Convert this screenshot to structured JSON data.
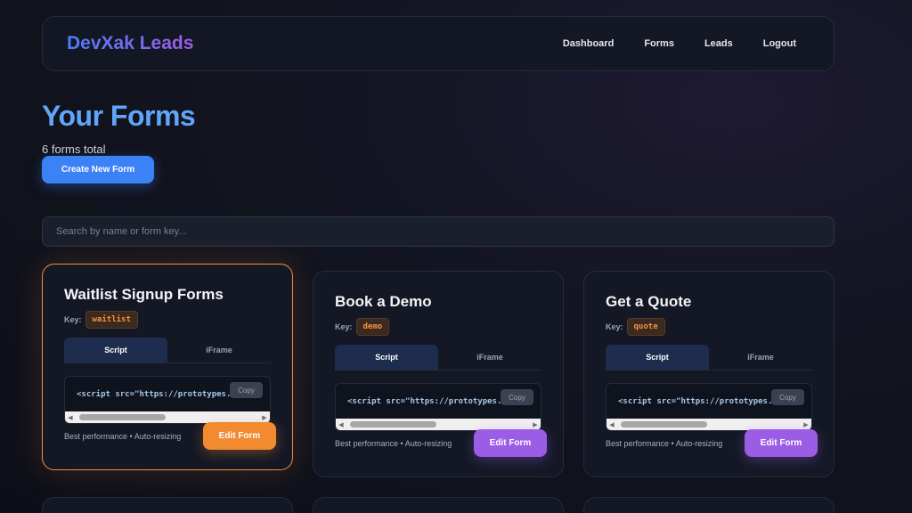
{
  "nav": {
    "brand": "DevXak Leads",
    "links": [
      "Dashboard",
      "Forms",
      "Leads",
      "Logout"
    ]
  },
  "header": {
    "title": "Your Forms",
    "count": "6 forms total",
    "create_label": "Create New Form"
  },
  "search": {
    "placeholder": "Search by name or form key..."
  },
  "common": {
    "key_label": "Key:",
    "tab_script": "Script",
    "tab_iframe": "iFrame",
    "code_snippet": "<script src=\"https://prototypes.devxak",
    "copy_label": "Copy",
    "footer_text": "Best performance • Auto-resizing",
    "edit_label": "Edit Form"
  },
  "forms": [
    {
      "title": "Waitlist Signup Forms",
      "key": "waitlist"
    },
    {
      "title": "Book a Demo",
      "key": "demo"
    },
    {
      "title": "Get a Quote",
      "key": "quote"
    }
  ],
  "colors": {
    "accent_blue": "#3b82f6",
    "accent_orange": "#f28a30",
    "accent_purple": "#9b5de5"
  }
}
